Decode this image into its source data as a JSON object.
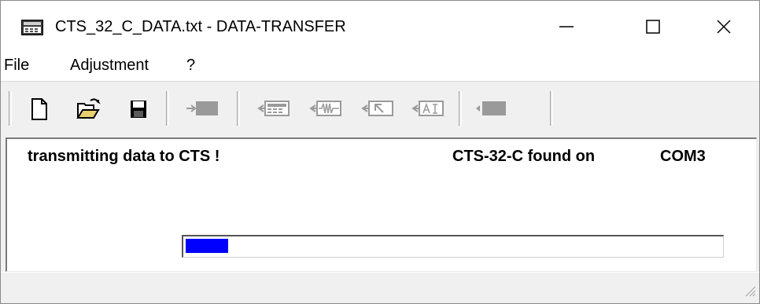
{
  "window": {
    "title": "CTS_32_C_DATA.txt - DATA-TRANSFER",
    "icon": "app-window-icon"
  },
  "menu": {
    "items": [
      "File",
      "Adjustment",
      "?"
    ]
  },
  "toolbar": {
    "tools": [
      {
        "name": "new-file",
        "icon": "new-document-icon"
      },
      {
        "name": "open-file",
        "icon": "open-folder-icon"
      },
      {
        "name": "save-file",
        "icon": "floppy-save-icon"
      },
      {
        "name": "send-to-device",
        "icon": "send-arrow-icon"
      },
      {
        "name": "receive-display",
        "icon": "receive-display-icon"
      },
      {
        "name": "receive-waveform",
        "icon": "receive-waveform-icon"
      },
      {
        "name": "receive-cursor",
        "icon": "receive-cursor-icon"
      },
      {
        "name": "receive-ai",
        "icon": "receive-ai-icon"
      },
      {
        "name": "device-block",
        "icon": "device-block-icon"
      }
    ]
  },
  "client": {
    "status_message": "transmitting data to CTS !",
    "found_label": "CTS-32-C found on",
    "port": "COM3"
  },
  "progress": {
    "fraction": 0.08,
    "fill_color": "#0000ff"
  },
  "colors": {
    "titlebar_bg": "#ffffff",
    "window_bg": "#f0f0f0",
    "toolbar_icon_gray": "#9a9a9a"
  }
}
